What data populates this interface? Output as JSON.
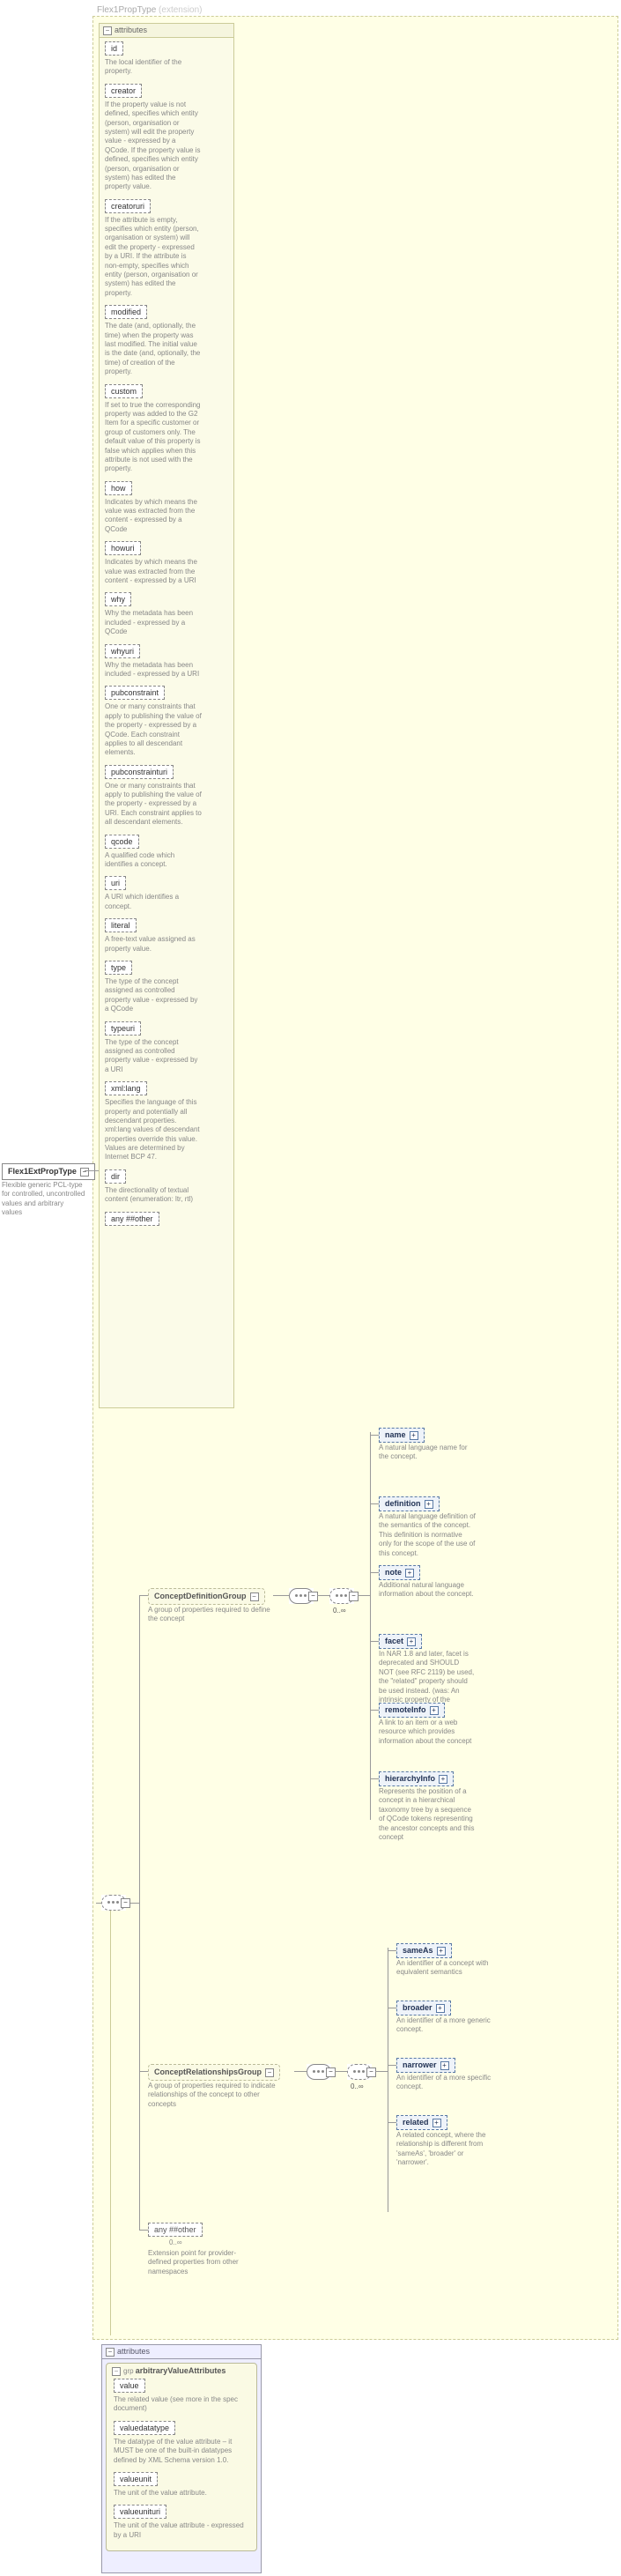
{
  "root": {
    "name": "Flex1ExtPropType",
    "desc": "Flexible generic PCL-type for controlled, uncontrolled values and arbitrary values"
  },
  "ext_name": "Flex1PropType",
  "ext_word": "(extension)",
  "top_attr_header": "attributes",
  "attrs": [
    {
      "name": "id",
      "desc": "The local identifier of the property."
    },
    {
      "name": "creator",
      "desc": "If the property value is not defined, specifies which entity (person, organisation or system) will edit the property value - expressed by a QCode. If the property value is defined, specifies which entity (person, organisation or system) has edited the property value."
    },
    {
      "name": "creatoruri",
      "desc": "If the attribute is empty, specifies which entity (person, organisation or system) will edit the property - expressed by a URI. If the attribute is non-empty, specifies which entity (person, organisation or system) has edited the property."
    },
    {
      "name": "modified",
      "desc": "The date (and, optionally, the time) when the property was last modified. The initial value is the date (and, optionally, the time) of creation of the property."
    },
    {
      "name": "custom",
      "desc": "If set to true the corresponding property was added to the G2 Item for a specific customer or group of customers only. The default value of this property is false which applies when this attribute is not used with the property."
    },
    {
      "name": "how",
      "desc": "Indicates by which means the value was extracted from the content - expressed by a QCode"
    },
    {
      "name": "howuri",
      "desc": "Indicates by which means the value was extracted from the content - expressed by a URI"
    },
    {
      "name": "why",
      "desc": "Why the metadata has been included - expressed by a QCode"
    },
    {
      "name": "whyuri",
      "desc": "Why the metadata has been included - expressed by a URI"
    },
    {
      "name": "pubconstraint",
      "desc": "One or many constraints that apply to publishing the value of the property - expressed by a QCode. Each constraint applies to all descendant elements."
    },
    {
      "name": "pubconstrainturi",
      "desc": "One or many constraints that apply to publishing the value of the property - expressed by a URI. Each constraint applies to all descendant elements."
    },
    {
      "name": "qcode",
      "desc": "A qualified code which identifies a concept."
    },
    {
      "name": "uri",
      "desc": "A URI which identifies a concept."
    },
    {
      "name": "literal",
      "desc": "A free-text value assigned as property value."
    },
    {
      "name": "type",
      "desc": "The type of the concept assigned as controlled property value - expressed by a QCode"
    },
    {
      "name": "typeuri",
      "desc": "The type of the concept assigned as controlled property value - expressed by a URI"
    },
    {
      "name": "xml:lang",
      "desc": "Specifies the language of this property and potentially all descendant properties. xml:lang values of descendant properties override this value. Values are determined by Internet BCP 47."
    },
    {
      "name": "dir",
      "desc": "The directionality of textual content (enumeration: ltr, rtl)"
    }
  ],
  "top_any": "any ##other",
  "groups": {
    "def": {
      "name": "ConceptDefinitionGroup",
      "desc": "A group of properties required to define the concept"
    },
    "rel": {
      "name": "ConceptRelationshipsGroup",
      "desc": "A group of properties required to indicate relationships of the concept to other concepts"
    }
  },
  "def_elems": [
    {
      "name": "name",
      "desc": "A natural language name for the concept."
    },
    {
      "name": "definition",
      "desc": "A natural language definition of the semantics of the concept. This definition is normative only for the scope of the use of this concept."
    },
    {
      "name": "note",
      "desc": "Additional natural language information about the concept."
    },
    {
      "name": "facet",
      "desc": "In NAR 1.8 and later, facet is deprecated and SHOULD NOT (see RFC 2119) be used, the \"related\" property should be used instead. (was: An intrinsic property of the concept.)"
    },
    {
      "name": "remoteInfo",
      "desc": "A link to an item or a web resource which provides information about the concept"
    },
    {
      "name": "hierarchyInfo",
      "desc": "Represents the position of a concept in a hierarchical taxonomy tree by a sequence of QCode tokens representing the ancestor concepts and this concept"
    }
  ],
  "rel_elems": [
    {
      "name": "sameAs",
      "desc": "An identifier of a concept with equivalent semantics"
    },
    {
      "name": "broader",
      "desc": "An identifier of a more generic concept."
    },
    {
      "name": "narrower",
      "desc": "An identifier of a more specific concept."
    },
    {
      "name": "related",
      "desc": "A related concept, where the relationship is different from 'sameAs', 'broader' or 'narrower'."
    }
  ],
  "bot_any": {
    "label": "any ##other",
    "card": "0..∞",
    "desc": "Extension point for provider-defined properties from other namespaces"
  },
  "bot_attr_header": "attributes",
  "bot_group_kind": "grp",
  "bot_group_name": "arbitraryValueAttributes",
  "bot_attrs": [
    {
      "name": "value",
      "desc": "The related value (see more in the spec document)"
    },
    {
      "name": "valuedatatype",
      "desc": "The datatype of the value attribute – it MUST be one of the built-in datatypes defined by XML Schema version 1.0."
    },
    {
      "name": "valueunit",
      "desc": "The unit of the value attribute."
    },
    {
      "name": "valueunituri",
      "desc": "The unit of the value attribute - expressed by a URI"
    }
  ],
  "card_inf": "0..∞"
}
